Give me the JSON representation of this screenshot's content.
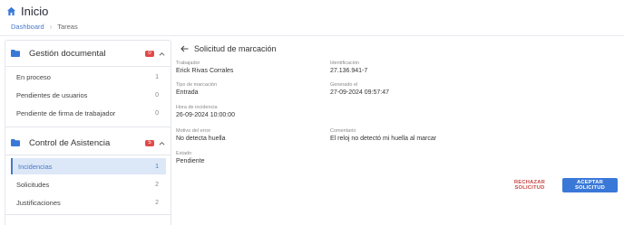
{
  "header": {
    "title": "Inicio",
    "icon": "home-icon"
  },
  "breadcrumb": {
    "items": [
      "Dashboard",
      "Tareas"
    ],
    "separator": "›"
  },
  "sidebar": {
    "sections": [
      {
        "title": "Gestión documental",
        "badge": "0",
        "icon": "folder-icon",
        "items": [
          {
            "label": "En proceso",
            "count": "1"
          },
          {
            "label": "Pendientes de usuarios",
            "count": "0"
          },
          {
            "label": "Pendiente de firma de trabajador",
            "count": "0"
          }
        ]
      },
      {
        "title": "Control de Asistencia",
        "badge": "5",
        "icon": "folder-icon",
        "items": [
          {
            "label": "Incidencias",
            "count": "1",
            "active": true
          },
          {
            "label": "Solicitudes",
            "count": "2"
          },
          {
            "label": "Justificaciones",
            "count": "2"
          }
        ]
      }
    ]
  },
  "detail": {
    "title": "Solicitud de marcación",
    "fields": {
      "trabajador": {
        "label": "Trabajador",
        "value": "Erick Rivas Corrales"
      },
      "identificacion": {
        "label": "Identificación",
        "value": "27.136.941-7"
      },
      "tipo": {
        "label": "Tipo de marcación",
        "value": "Entrada"
      },
      "generado": {
        "label": "Generado el",
        "value": "27-09-2024 09:57:47"
      },
      "hora": {
        "label": "Hora de incidencia",
        "value": "26-09-2024 10:00:00"
      },
      "motivo": {
        "label": "Motivo del error",
        "value": "No detecta huella"
      },
      "comentario": {
        "label": "Comentario",
        "value": "El reloj no detectó mi huella al marcar"
      },
      "estado": {
        "label": "Estado",
        "value": "Pendiente"
      }
    },
    "actions": {
      "reject": "RECHAZAR SOLICITUD",
      "accept": "ACEPTAR SOLICITUD"
    }
  },
  "colors": {
    "accent": "#3a78d8",
    "badge": "#e04a4a",
    "active_bg": "#dce8f7",
    "reject": "#c94848"
  }
}
